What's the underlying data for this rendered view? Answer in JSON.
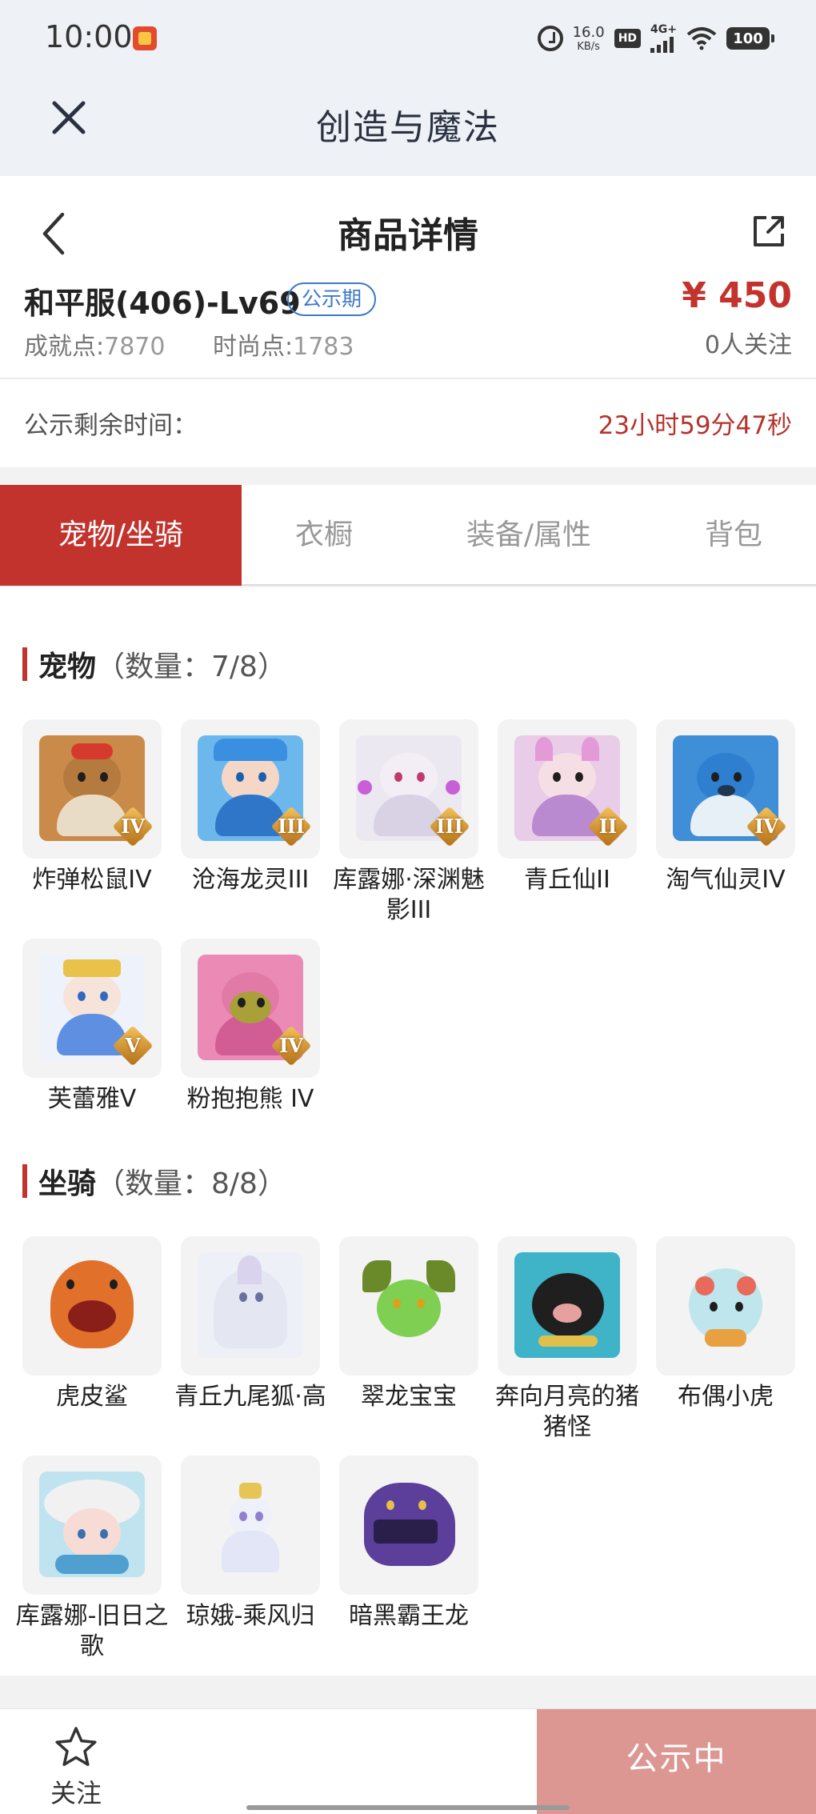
{
  "status_bar": {
    "time": "10:00",
    "net_speed": "16.0",
    "net_speed_unit": "KB/s",
    "hd_label": "HD",
    "network": "4G+",
    "battery": "100"
  },
  "app_header": {
    "title": "创造与魔法"
  },
  "detail_header": {
    "title": "商品详情"
  },
  "item": {
    "name": "和平服(406)-Lv69",
    "badge": "公示期",
    "price": "¥ 450",
    "achievement_label": "成就点:",
    "achievement_value": "7870",
    "fashion_label": "时尚点:",
    "fashion_value": "1783",
    "followers": "0人关注"
  },
  "countdown": {
    "label": "公示剩余时间：",
    "value": "23小时59分47秒"
  },
  "tabs": [
    {
      "label": "宠物/坐骑",
      "active": true
    },
    {
      "label": "衣橱",
      "active": false
    },
    {
      "label": "装备/属性",
      "active": false
    },
    {
      "label": "背包",
      "active": false
    }
  ],
  "pets_section": {
    "title": "宠物",
    "count": "（数量：7/8）",
    "items": [
      {
        "label": "炸弹松鼠IV",
        "rank": "IV",
        "icon": "squirrel-icon"
      },
      {
        "label": "沧海龙灵III",
        "rank": "III",
        "icon": "dragon-spirit-icon"
      },
      {
        "label": "库露娜·深渊魅影III",
        "rank": "III",
        "icon": "kuluna-icon"
      },
      {
        "label": "青丘仙II",
        "rank": "II",
        "icon": "fox-fairy-icon"
      },
      {
        "label": "淘气仙灵IV",
        "rank": "IV",
        "icon": "blue-puppy-icon"
      },
      {
        "label": "芙蕾雅V",
        "rank": "V",
        "icon": "freya-icon"
      },
      {
        "label": "粉抱抱熊 IV",
        "rank": "IV",
        "icon": "pink-bear-icon"
      }
    ]
  },
  "mounts_section": {
    "title": "坐骑",
    "count": "（数量：8/8）",
    "items": [
      {
        "label": "虎皮鲨",
        "icon": "tiger-shark-icon"
      },
      {
        "label": "青丘九尾狐·高",
        "icon": "nine-tail-fox-icon"
      },
      {
        "label": "翠龙宝宝",
        "icon": "green-dragon-icon"
      },
      {
        "label": "奔向月亮的猪猪怪",
        "icon": "moon-pig-icon"
      },
      {
        "label": "布偶小虎",
        "icon": "doll-tiger-icon"
      },
      {
        "label": "库露娜-旧日之歌",
        "icon": "kuluna-song-icon"
      },
      {
        "label": "琼娥-乘风归",
        "icon": "qiong-e-icon"
      },
      {
        "label": "暗黑霸王龙",
        "icon": "dark-trex-icon"
      }
    ]
  },
  "bottom_bar": {
    "follow_label": "关注",
    "status_label": "公示中"
  },
  "colors": {
    "accent": "#c3332e",
    "badge_blue": "#3b79c6",
    "status_button": "#dd9793"
  }
}
